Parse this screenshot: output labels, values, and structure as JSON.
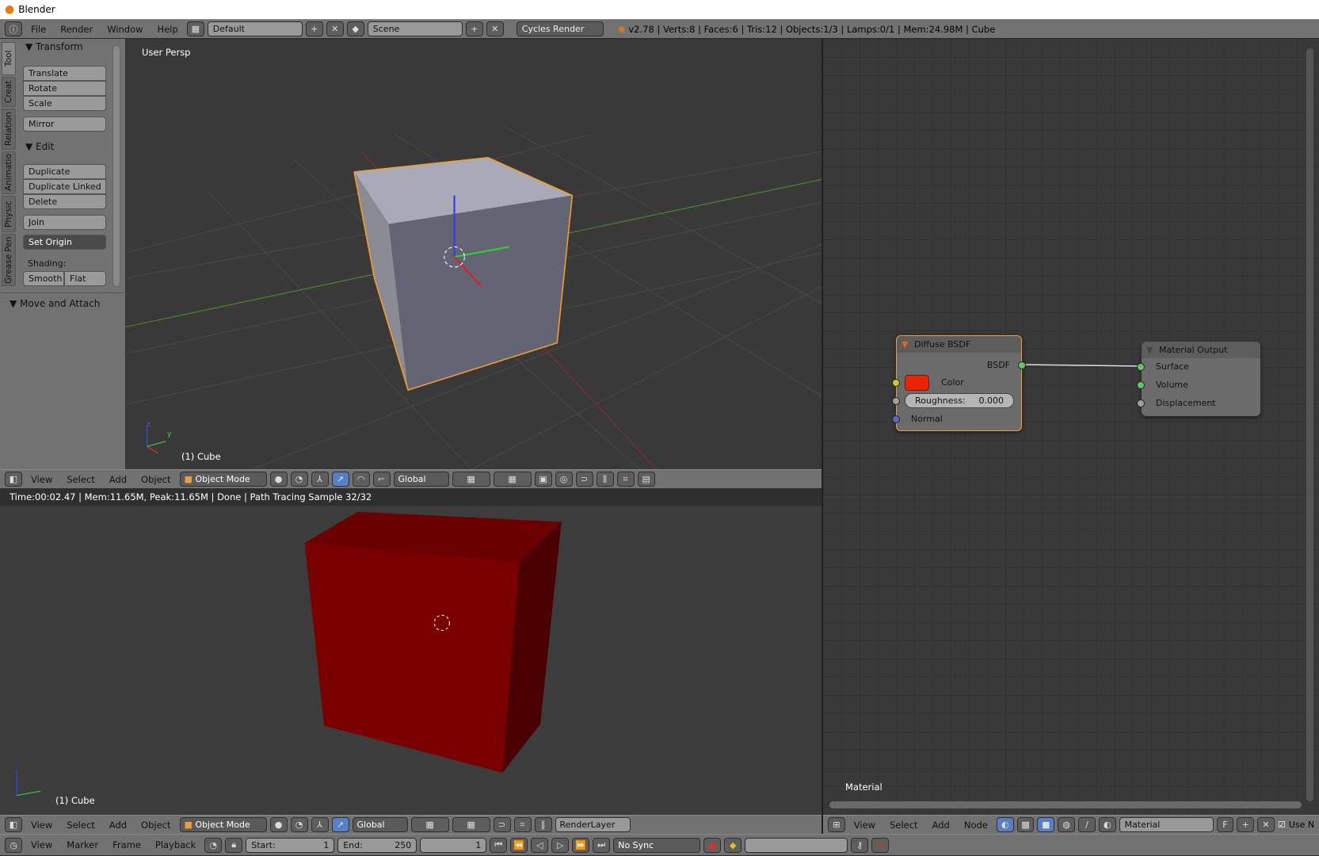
{
  "window": {
    "title": "Blender"
  },
  "info_header": {
    "menus": [
      "File",
      "Render",
      "Window",
      "Help"
    ],
    "screen_layout": "Default",
    "scene": "Scene",
    "render_engine": "Cycles Render",
    "stats": "v2.78 | Verts:8 | Faces:6 | Tris:12 | Objects:1/3 | Lamps:0/1 | Mem:24.98M | Cube"
  },
  "tool_shelf": {
    "tabs": [
      "Tool",
      "Creat",
      "Relation",
      "Animatio",
      "Physic",
      "Grease Pen"
    ],
    "transform": {
      "title": "Transform",
      "buttons": [
        "Translate",
        "Rotate",
        "Scale",
        "Mirror"
      ]
    },
    "edit": {
      "title": "Edit",
      "buttons": [
        "Duplicate",
        "Duplicate Linked",
        "Delete",
        "Join"
      ],
      "set_origin": "Set Origin",
      "shading_label": "Shading:",
      "smooth": "Smooth",
      "flat": "Flat"
    },
    "move_attach": "Move and Attach"
  },
  "viewport": {
    "label": "User Persp",
    "object": "(1) Cube",
    "axis_x": "x",
    "axis_y": "y",
    "axis_z": "z"
  },
  "view3d_header": {
    "menus": [
      "View",
      "Select",
      "Add",
      "Object"
    ],
    "mode": "Object Mode",
    "orientation": "Global"
  },
  "render_view": {
    "status": "Time:00:02.47 | Mem:11.65M, Peak:11.65M | Done | Path Tracing Sample 32/32",
    "object": "(1) Cube",
    "render_layer": "RenderLayer"
  },
  "node_editor": {
    "material_label": "Material",
    "menus": [
      "View",
      "Select",
      "Add",
      "Node"
    ],
    "material": "Material",
    "fake_user": "F",
    "use_nodes": "Use N",
    "diffuse": {
      "title": "Diffuse BSDF",
      "output": "BSDF",
      "color_label": "Color",
      "color": "#ee2200",
      "roughness_label": "Roughness:",
      "roughness": "0.000",
      "normal": "Normal"
    },
    "output": {
      "title": "Material Output",
      "inputs": [
        "Surface",
        "Volume",
        "Displacement"
      ]
    }
  },
  "timeline": {
    "menus": [
      "View",
      "Marker",
      "Frame",
      "Playback"
    ],
    "start_label": "Start:",
    "start": "1",
    "end_label": "End:",
    "end": "250",
    "current": "1",
    "sync": "No Sync"
  },
  "colors": {
    "selection": "#f39c2c",
    "grid_green": "#4c8c2c",
    "grid_red": "#8c2c2c",
    "cube_render": "#7a0000"
  }
}
